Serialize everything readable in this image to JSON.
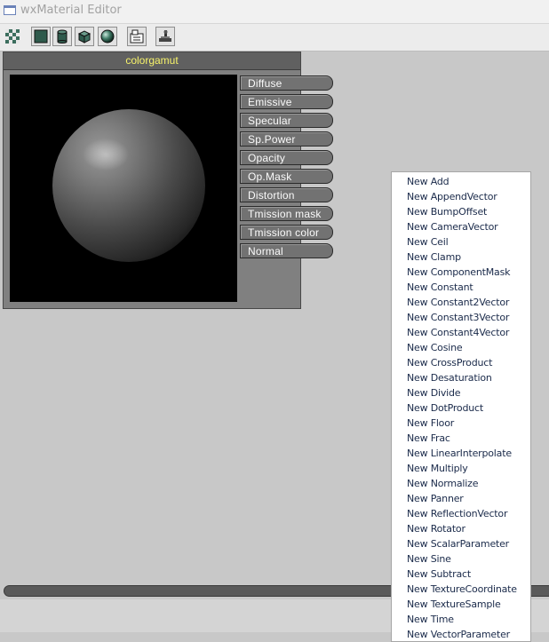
{
  "window": {
    "title": "wxMaterial Editor"
  },
  "toolbar": {
    "buttons": [
      {
        "icon": "checker-background-icon",
        "active": false
      },
      {
        "icon": "plane-preview-icon",
        "active": true
      },
      {
        "icon": "cylinder-preview-icon",
        "active": true
      },
      {
        "icon": "cube-preview-icon",
        "active": true
      },
      {
        "icon": "sphere-preview-icon",
        "active": true
      },
      {
        "icon": "node-layout-icon",
        "active": true
      },
      {
        "icon": "apply-icon",
        "active": true
      }
    ]
  },
  "node": {
    "title": "colorgamut",
    "inputs": [
      "Diffuse",
      "Emissive",
      "Specular",
      "Sp.Power",
      "Opacity",
      "Op.Mask",
      "Distortion",
      "Tmission mask",
      "Tmission color",
      "Normal"
    ]
  },
  "context_menu": {
    "items": [
      "New Add",
      "New AppendVector",
      "New BumpOffset",
      "New CameraVector",
      "New Ceil",
      "New Clamp",
      "New ComponentMask",
      "New Constant",
      "New Constant2Vector",
      "New Constant3Vector",
      "New Constant4Vector",
      "New Cosine",
      "New CrossProduct",
      "New Desaturation",
      "New Divide",
      "New DotProduct",
      "New Floor",
      "New Frac",
      "New LinearInterpolate",
      "New Multiply",
      "New Normalize",
      "New Panner",
      "New ReflectionVector",
      "New Rotator",
      "New ScalarParameter",
      "New Sine",
      "New Subtract",
      "New TextureCoordinate",
      "New TextureSample",
      "New Time",
      "New VectorParameter"
    ]
  },
  "colors": {
    "canvas": "#c8c8c8",
    "node_body": "#808080",
    "node_title_text": "#f7f36a",
    "slot_fill": "#727272"
  }
}
